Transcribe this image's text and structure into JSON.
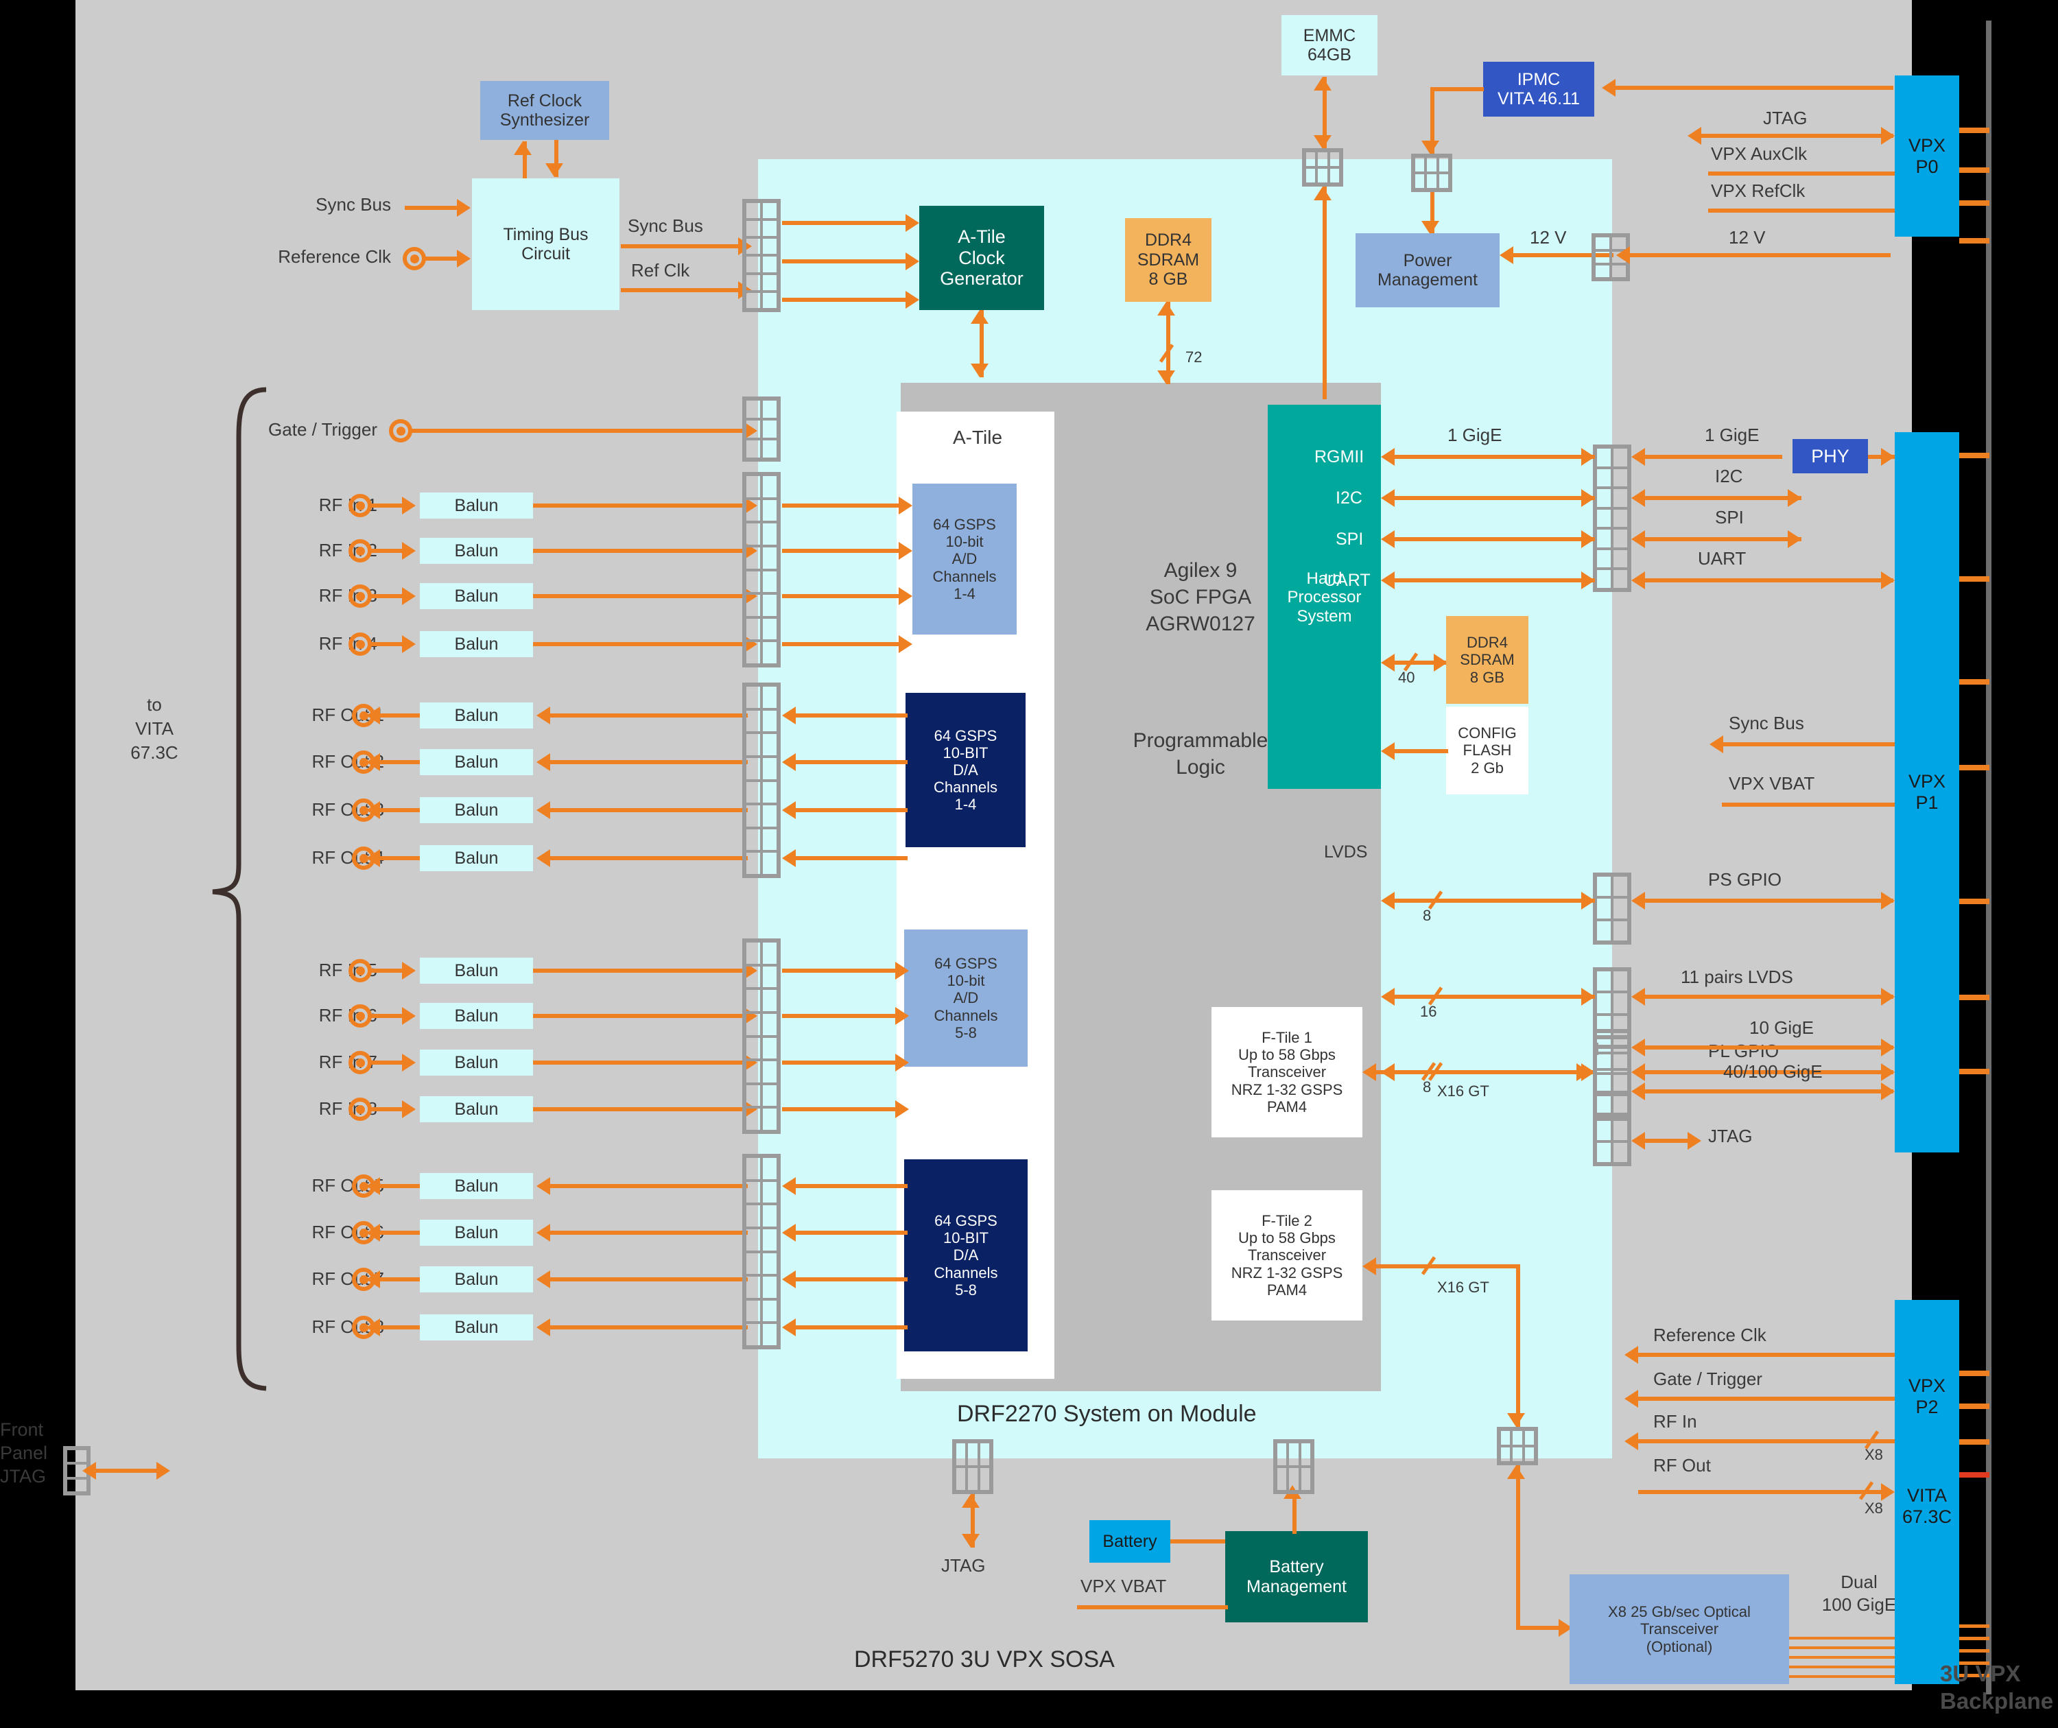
{
  "diagram": {
    "title": "DRF5270 3U VPX SOSA",
    "module_title": "DRF2270 System on Module",
    "backplane_label": "3U VPX\nBackplane",
    "front_panel_label": "Front\nPanel\nJTAG",
    "vita_brace_label": "to\nVITA\n67.3C"
  },
  "colors": {
    "orange": "#ef8022",
    "carrier_gray": "#cccccc",
    "som_cyan": "#d2fafb",
    "fpga_gray": "#bdbdbd",
    "teal": "#00695c",
    "hps_teal": "#00a99b",
    "navy": "#0a2163",
    "sky": "#00a5e5",
    "ipmc_blue": "#3257c4",
    "ddr_orange": "#f2b35c",
    "light_blue": "#8fb0dd"
  },
  "blocks": {
    "ref_clock_synth": "Ref Clock\nSynthesizer",
    "timing_bus_circuit": "Timing Bus\nCircuit",
    "a_tile_clock_gen": "A-Tile\nClock\nGenerator",
    "emmc": "EMMC\n64GB",
    "ipmc": "IPMC\nVITA 46.11",
    "power_management": "Power\nManagement",
    "ddr4_top": "DDR4\nSDRAM\n8 GB",
    "ddr4_hps": "DDR4\nSDRAM\n8 GB",
    "config_flash": "CONFIG\nFLASH\n2 Gb",
    "fpga_name": "Agilex 9\nSoC FPGA\nAGRW0127",
    "programmable_logic": "Programmable\nLogic",
    "hard_processor_system": "Hard\nProcessor\nSystem",
    "a_tile_label": "A-Tile",
    "adc_1_4": "64 GSPS\n10-bit\nA/D\nChannels\n1-4",
    "dac_1_4": "64 GSPS\n10-BIT\nD/A\nChannels\n1-4",
    "adc_5_8": "64 GSPS\n10-bit\nA/D\nChannels\n5-8",
    "dac_5_8": "64 GSPS\n10-BIT\nD/A\nChannels\n5-8",
    "ftile1": "F-Tile 1\nUp to 58 Gbps\nTransceiver\nNRZ 1-32 GSPS\nPAM4",
    "ftile2": "F-Tile 2\nUp to 58 Gbps\nTransceiver\nNRZ 1-32 GSPS\nPAM4",
    "phy": "PHY",
    "battery": "Battery",
    "battery_management": "Battery\nManagement",
    "optical_transceiver": "X8 25 Gb/sec Optical\nTransceiver\n(Optional)",
    "balun": "Balun",
    "vpx_p0": "VPX\nP0",
    "vpx_p1": "VPX\nP1",
    "vpx_p2": "VPX\nP2\n\nVITA\n67.3C",
    "vpx_p2_top": "VPX\nP2",
    "vpx_p2_bottom": "VITA\n67.3C"
  },
  "signals": {
    "sync_bus_in": "Sync Bus",
    "reference_clk_in": "Reference Clk",
    "sync_bus_mid": "Sync Bus",
    "ref_clk_mid": "Ref Clk",
    "gate_trigger": "Gate / Trigger",
    "jtag_p0": "JTAG",
    "vpx_auxclk": "VPX AuxClk",
    "vpx_refclk": "VPX RefClk",
    "v12_left": "12 V",
    "v12_right": "12 V",
    "rgmii": "RGMII",
    "i2c_fpga": "I2C",
    "spi_fpga": "SPI",
    "uart_fpga": "UART",
    "gige_left": "1 GigE",
    "gige_right": "1 GigE",
    "i2c_right": "I2C",
    "spi_right": "SPI",
    "uart_right": "UART",
    "sync_bus_right": "Sync Bus",
    "vpx_vbat_right": "VPX VBAT",
    "ps_gpio": "PS GPIO",
    "lvds_label": "LVDS",
    "lvds_pairs": "11 pairs LVDS",
    "pl_gpio": "PL GPIO",
    "jtag_p1": "JTAG",
    "gige10": "10 GigE",
    "gige40_100": "40/100 GigE",
    "x16_gt_1": "X16  GT",
    "x16_gt_2": "X16  GT",
    "jtag_bottom": "JTAG",
    "vpx_vbat_bottom": "VPX VBAT",
    "dual_100gige": "Dual\n100 GigE",
    "reference_clk_p2": "Reference Clk",
    "gate_trigger_p2": "Gate / Trigger",
    "rf_in_p2": "RF In",
    "rf_out_p2": "RF Out"
  },
  "bit_widths": {
    "ddr4_top_72": "72",
    "ddr4_hps_40": "40",
    "ps_gpio_8": "8",
    "lvds_16": "16",
    "pl_gpio_8": "8",
    "rf_in_x8": "X8",
    "rf_out_x8": "X8"
  },
  "rf_inputs": [
    {
      "label": "RF In 1"
    },
    {
      "label": "RF In 2"
    },
    {
      "label": "RF In 3"
    },
    {
      "label": "RF In 4"
    },
    {
      "label": "RF In 5"
    },
    {
      "label": "RF In 6"
    },
    {
      "label": "RF In 7"
    },
    {
      "label": "RF In 8"
    }
  ],
  "rf_outputs": [
    {
      "label": "RF Out 1"
    },
    {
      "label": "RF Out 2"
    },
    {
      "label": "RF Out 3"
    },
    {
      "label": "RF Out 4"
    },
    {
      "label": "RF Out 5"
    },
    {
      "label": "RF Out 6"
    },
    {
      "label": "RF Out 7"
    },
    {
      "label": "RF Out 8"
    }
  ]
}
